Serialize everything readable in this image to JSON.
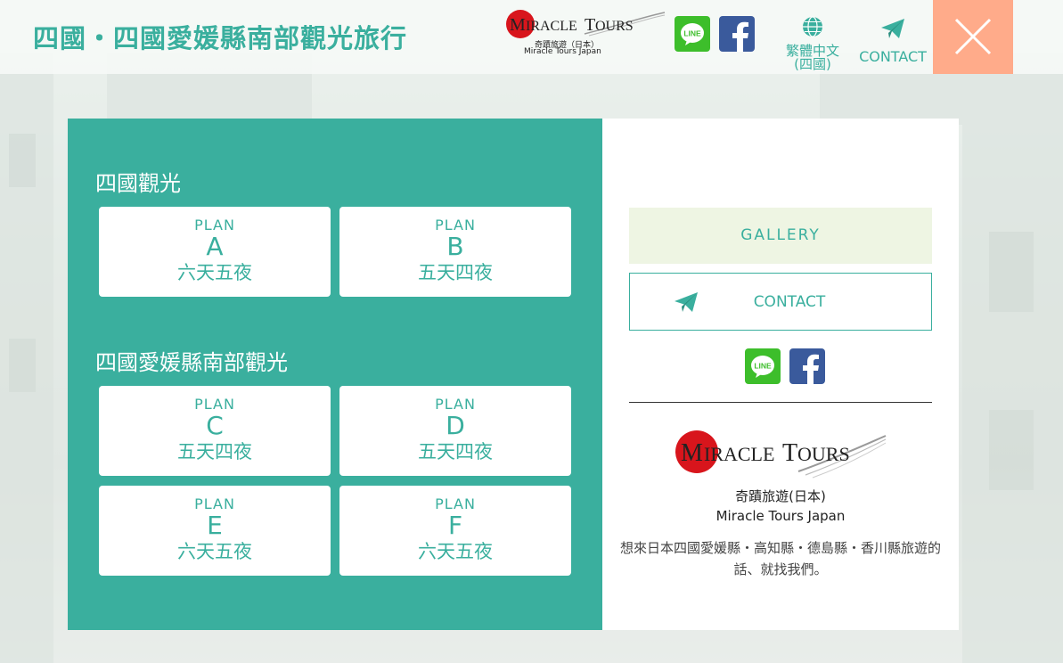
{
  "header": {
    "title": "四國・四國愛媛縣南部觀光旅行",
    "logo": {
      "text": "MIRACLE TOURS",
      "subtitle_ja": "奇蹟旅遊（日本）",
      "subtitle_en": "Miracle Tours Japan"
    },
    "line_icon": "line-icon",
    "line_label": "LINE",
    "facebook_icon": "facebook-icon",
    "language_label": "繁體中文(四國)",
    "contact_label": "CONTACT",
    "close_icon": "close-icon"
  },
  "menu": {
    "sections": [
      {
        "heading": "四國觀光",
        "plans": [
          {
            "word": "PLAN",
            "letter": "A",
            "duration": "六天五夜"
          },
          {
            "word": "PLAN",
            "letter": "B",
            "duration": "五天四夜"
          }
        ]
      },
      {
        "heading": "四國愛媛縣南部觀光",
        "plans": [
          {
            "word": "PLAN",
            "letter": "C",
            "duration": "五天四夜"
          },
          {
            "word": "PLAN",
            "letter": "D",
            "duration": "五天四夜"
          },
          {
            "word": "PLAN",
            "letter": "E",
            "duration": "六天五夜"
          },
          {
            "word": "PLAN",
            "letter": "F",
            "duration": "六天五夜"
          }
        ]
      }
    ]
  },
  "sidebar": {
    "gallery_label": "GALLERY",
    "contact_label": "CONTACT",
    "line_label": "LINE",
    "logo_text": "MIRACLE TOURS",
    "company_name_ja": "奇蹟旅遊(日本)",
    "company_name_en": "Miracle Tours Japan",
    "description": "想來日本四國愛媛縣・高知縣・德島縣・香川縣旅遊的話、就找我們。"
  },
  "colors": {
    "accent": "#3aaf9e",
    "close_button": "#ffab8a",
    "gallery_bg": "#eef5e3",
    "line_green": "#3dbe2b",
    "facebook_blue": "#3a5a9c",
    "logo_red": "#d8151c"
  }
}
